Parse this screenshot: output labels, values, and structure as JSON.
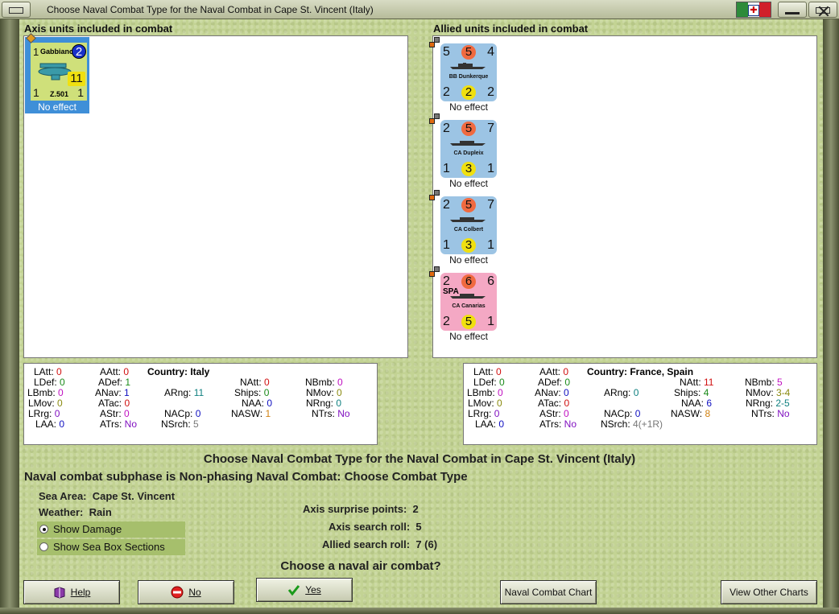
{
  "window": {
    "title": "Choose Naval Combat Type for the Naval Combat in Cape St. Vincent (Italy)"
  },
  "axis": {
    "header": "Axis units included in combat",
    "units": [
      {
        "name": "Gabbiano",
        "type": "Z.501",
        "top_left": "1",
        "top_right": "2",
        "mid_right": "11",
        "bottom_left": "1",
        "bottom_right": "1",
        "effect": "No effect",
        "color": "#cfe07a"
      }
    ],
    "stats": {
      "LAtt": "0",
      "LDef": "0",
      "LBmb": "0",
      "LMov": "0",
      "LRrg": "0",
      "LAA": "0",
      "AAtt": "0",
      "ADef": "1",
      "ANav": "1",
      "ATac": "0",
      "AStr": "0",
      "ATrs": "No",
      "country_label": "Country:",
      "country": "Italy",
      "ARng": "11",
      "NAtt": "0",
      "Ships": "0",
      "NAA": "0",
      "NASW": "1",
      "NACp": "0",
      "NSrch": "5",
      "NBmb": "0",
      "NMov": "0",
      "NRng": "0",
      "NTrs": "No"
    }
  },
  "allied": {
    "header": "Allied units included in combat",
    "units": [
      {
        "name": "BB Dunkerque",
        "nation": "",
        "tl": "5",
        "tc": "5",
        "tr": "4",
        "bl": "2",
        "bc": "2",
        "br": "2",
        "effect": "No effect",
        "color": "#9cc4e4"
      },
      {
        "name": "CA Dupleix",
        "nation": "",
        "tl": "2",
        "tc": "5",
        "tr": "7",
        "bl": "1",
        "bc": "3",
        "br": "1",
        "effect": "No effect",
        "color": "#9cc4e4"
      },
      {
        "name": "CA Colbert",
        "nation": "",
        "tl": "2",
        "tc": "5",
        "tr": "7",
        "bl": "1",
        "bc": "3",
        "br": "1",
        "effect": "No effect",
        "color": "#9cc4e4"
      },
      {
        "name": "CA Canarias",
        "nation": "SPA",
        "tl": "2",
        "tc": "6",
        "tr": "6",
        "bl": "2",
        "bc": "5",
        "br": "1",
        "effect": "No effect",
        "color": "#f4a8c4"
      }
    ],
    "stats": {
      "LAtt": "0",
      "LDef": "0",
      "LBmb": "0",
      "LMov": "0",
      "LRrg": "0",
      "LAA": "0",
      "AAtt": "0",
      "ADef": "0",
      "ANav": "0",
      "ATac": "0",
      "AStr": "0",
      "ATrs": "No",
      "country_label": "Country:",
      "country": "France, Spain",
      "ARng": "0",
      "NAtt": "11",
      "Ships": "4",
      "NAA": "6",
      "NASW": "8",
      "NACp": "0",
      "NSrch": "4(+1R)",
      "NBmb": "5",
      "NMov": "3-4",
      "NRng": "2-5",
      "NTrs": "No"
    }
  },
  "main_title": "Choose Naval Combat Type for the Naval Combat in Cape St. Vincent (Italy)",
  "subphase": "Naval combat subphase is Non-phasing Naval Combat: Choose Combat Type",
  "sea_area": {
    "label": "Sea Area:",
    "value": "Cape St. Vincent"
  },
  "weather": {
    "label": "Weather:",
    "value": "Rain"
  },
  "options": {
    "show_damage": "Show Damage",
    "show_sea_box": "Show Sea Box Sections"
  },
  "rolls": {
    "surprise_label": "Axis surprise points:",
    "surprise": "2",
    "axis_search_label": "Axis search roll:",
    "axis_search": "5",
    "allied_search_label": "Allied search roll:",
    "allied_search": "7 (6)"
  },
  "question": "Choose a naval air combat?",
  "buttons": {
    "help": "Help",
    "no": "No",
    "yes": "Yes",
    "naval_chart": "Naval Combat Chart",
    "other_charts": "View Other Charts"
  },
  "icons": {
    "help": "book-icon",
    "no": "no-entry-icon",
    "yes": "checkmark-icon",
    "close": "close-icon",
    "flag": "italy-flag-icon"
  }
}
